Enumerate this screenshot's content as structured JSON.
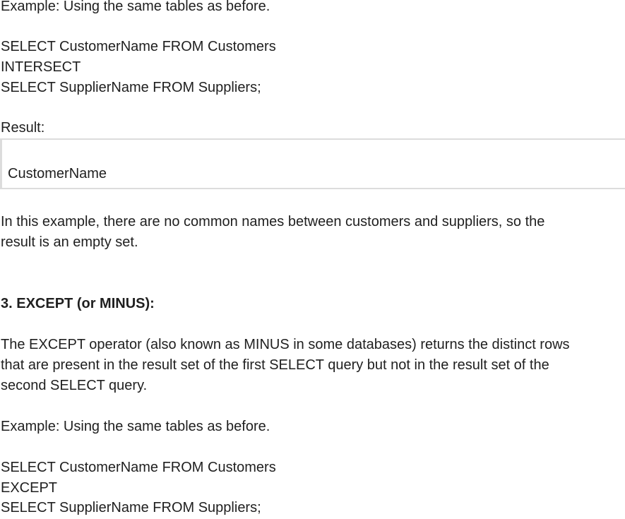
{
  "example1": {
    "intro": "Example: Using the same tables as before.",
    "query": [
      "SELECT CustomerName FROM Customers",
      "INTERSECT",
      "SELECT SupplierName FROM Suppliers;"
    ],
    "result_label": "Result:",
    "result_table": {
      "header": "CustomerName"
    },
    "explanation": [
      "In this example, there are no common names between customers and suppliers, so the",
      "result is an empty set."
    ]
  },
  "section3": {
    "heading": "3. EXCEPT (or MINUS):",
    "description": [
      "The EXCEPT operator (also known as MINUS in some databases) returns the distinct rows",
      "that are present in the result set of the first SELECT query but not in the result set of the",
      "second SELECT query."
    ]
  },
  "example2": {
    "intro": "Example: Using the same tables as before.",
    "query": [
      "SELECT CustomerName FROM Customers",
      "EXCEPT",
      "SELECT SupplierName FROM Suppliers;"
    ]
  }
}
